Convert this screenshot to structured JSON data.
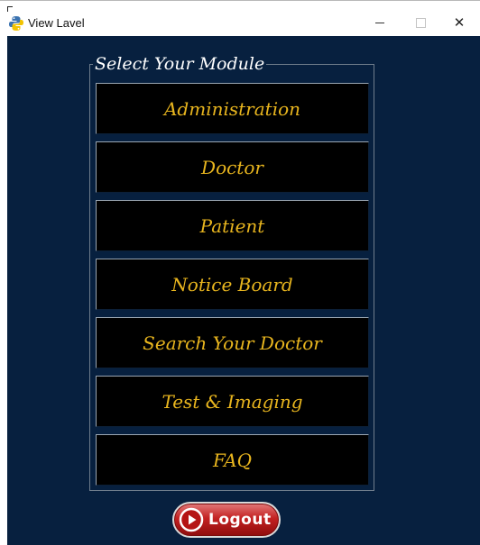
{
  "window": {
    "title": "View Lavel",
    "icon": "python-icon",
    "controls": {
      "minimize_icon": "minimize-icon",
      "maximize_icon": "maximize-icon",
      "close_icon": "close-icon",
      "close_glyph": "✕"
    }
  },
  "module_panel": {
    "legend": "Select Your Module",
    "buttons": [
      {
        "label": "Administration"
      },
      {
        "label": "Doctor"
      },
      {
        "label": "Patient"
      },
      {
        "label": "Notice Board"
      },
      {
        "label": "Search Your Doctor"
      },
      {
        "label": "Test & Imaging"
      },
      {
        "label": "FAQ"
      }
    ]
  },
  "logout": {
    "label": "Logout",
    "icon": "play-circle-icon"
  },
  "colors": {
    "background": "#07203f",
    "button_bg": "#000000",
    "button_text": "#e8b51e",
    "legend_text": "#ffffff",
    "logout_red": "#c42222"
  }
}
